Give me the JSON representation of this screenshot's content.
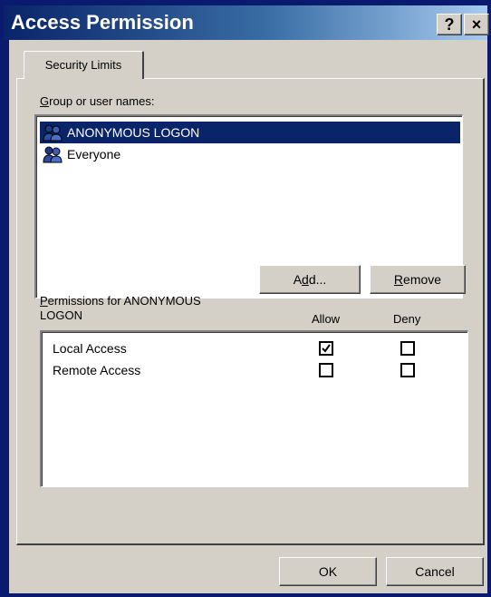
{
  "window": {
    "title": "Access Permission",
    "help_glyph": "?",
    "close_glyph": "×"
  },
  "tabs": [
    {
      "label": "Security Limits"
    }
  ],
  "group": {
    "label": "Group or user names:",
    "items": [
      {
        "label": "ANONYMOUS LOGON",
        "selected": true,
        "icon": "user-group-icon"
      },
      {
        "label": "Everyone",
        "selected": false,
        "icon": "user-group-icon"
      }
    ],
    "add_label": "Add...",
    "remove_label": "Remove"
  },
  "permissions": {
    "heading_line1": "Permissions for ANONYMOUS",
    "heading_line2": "LOGON",
    "allow_header": "Allow",
    "deny_header": "Deny",
    "rows": [
      {
        "label": "Local Access",
        "allow": true,
        "deny": false
      },
      {
        "label": "Remote Access",
        "allow": false,
        "deny": false
      }
    ]
  },
  "footer": {
    "ok_label": "OK",
    "cancel_label": "Cancel"
  },
  "colors": {
    "selection": "#0a246a",
    "dialog_face": "#d4d0c8",
    "background": "#0a1a6e"
  }
}
